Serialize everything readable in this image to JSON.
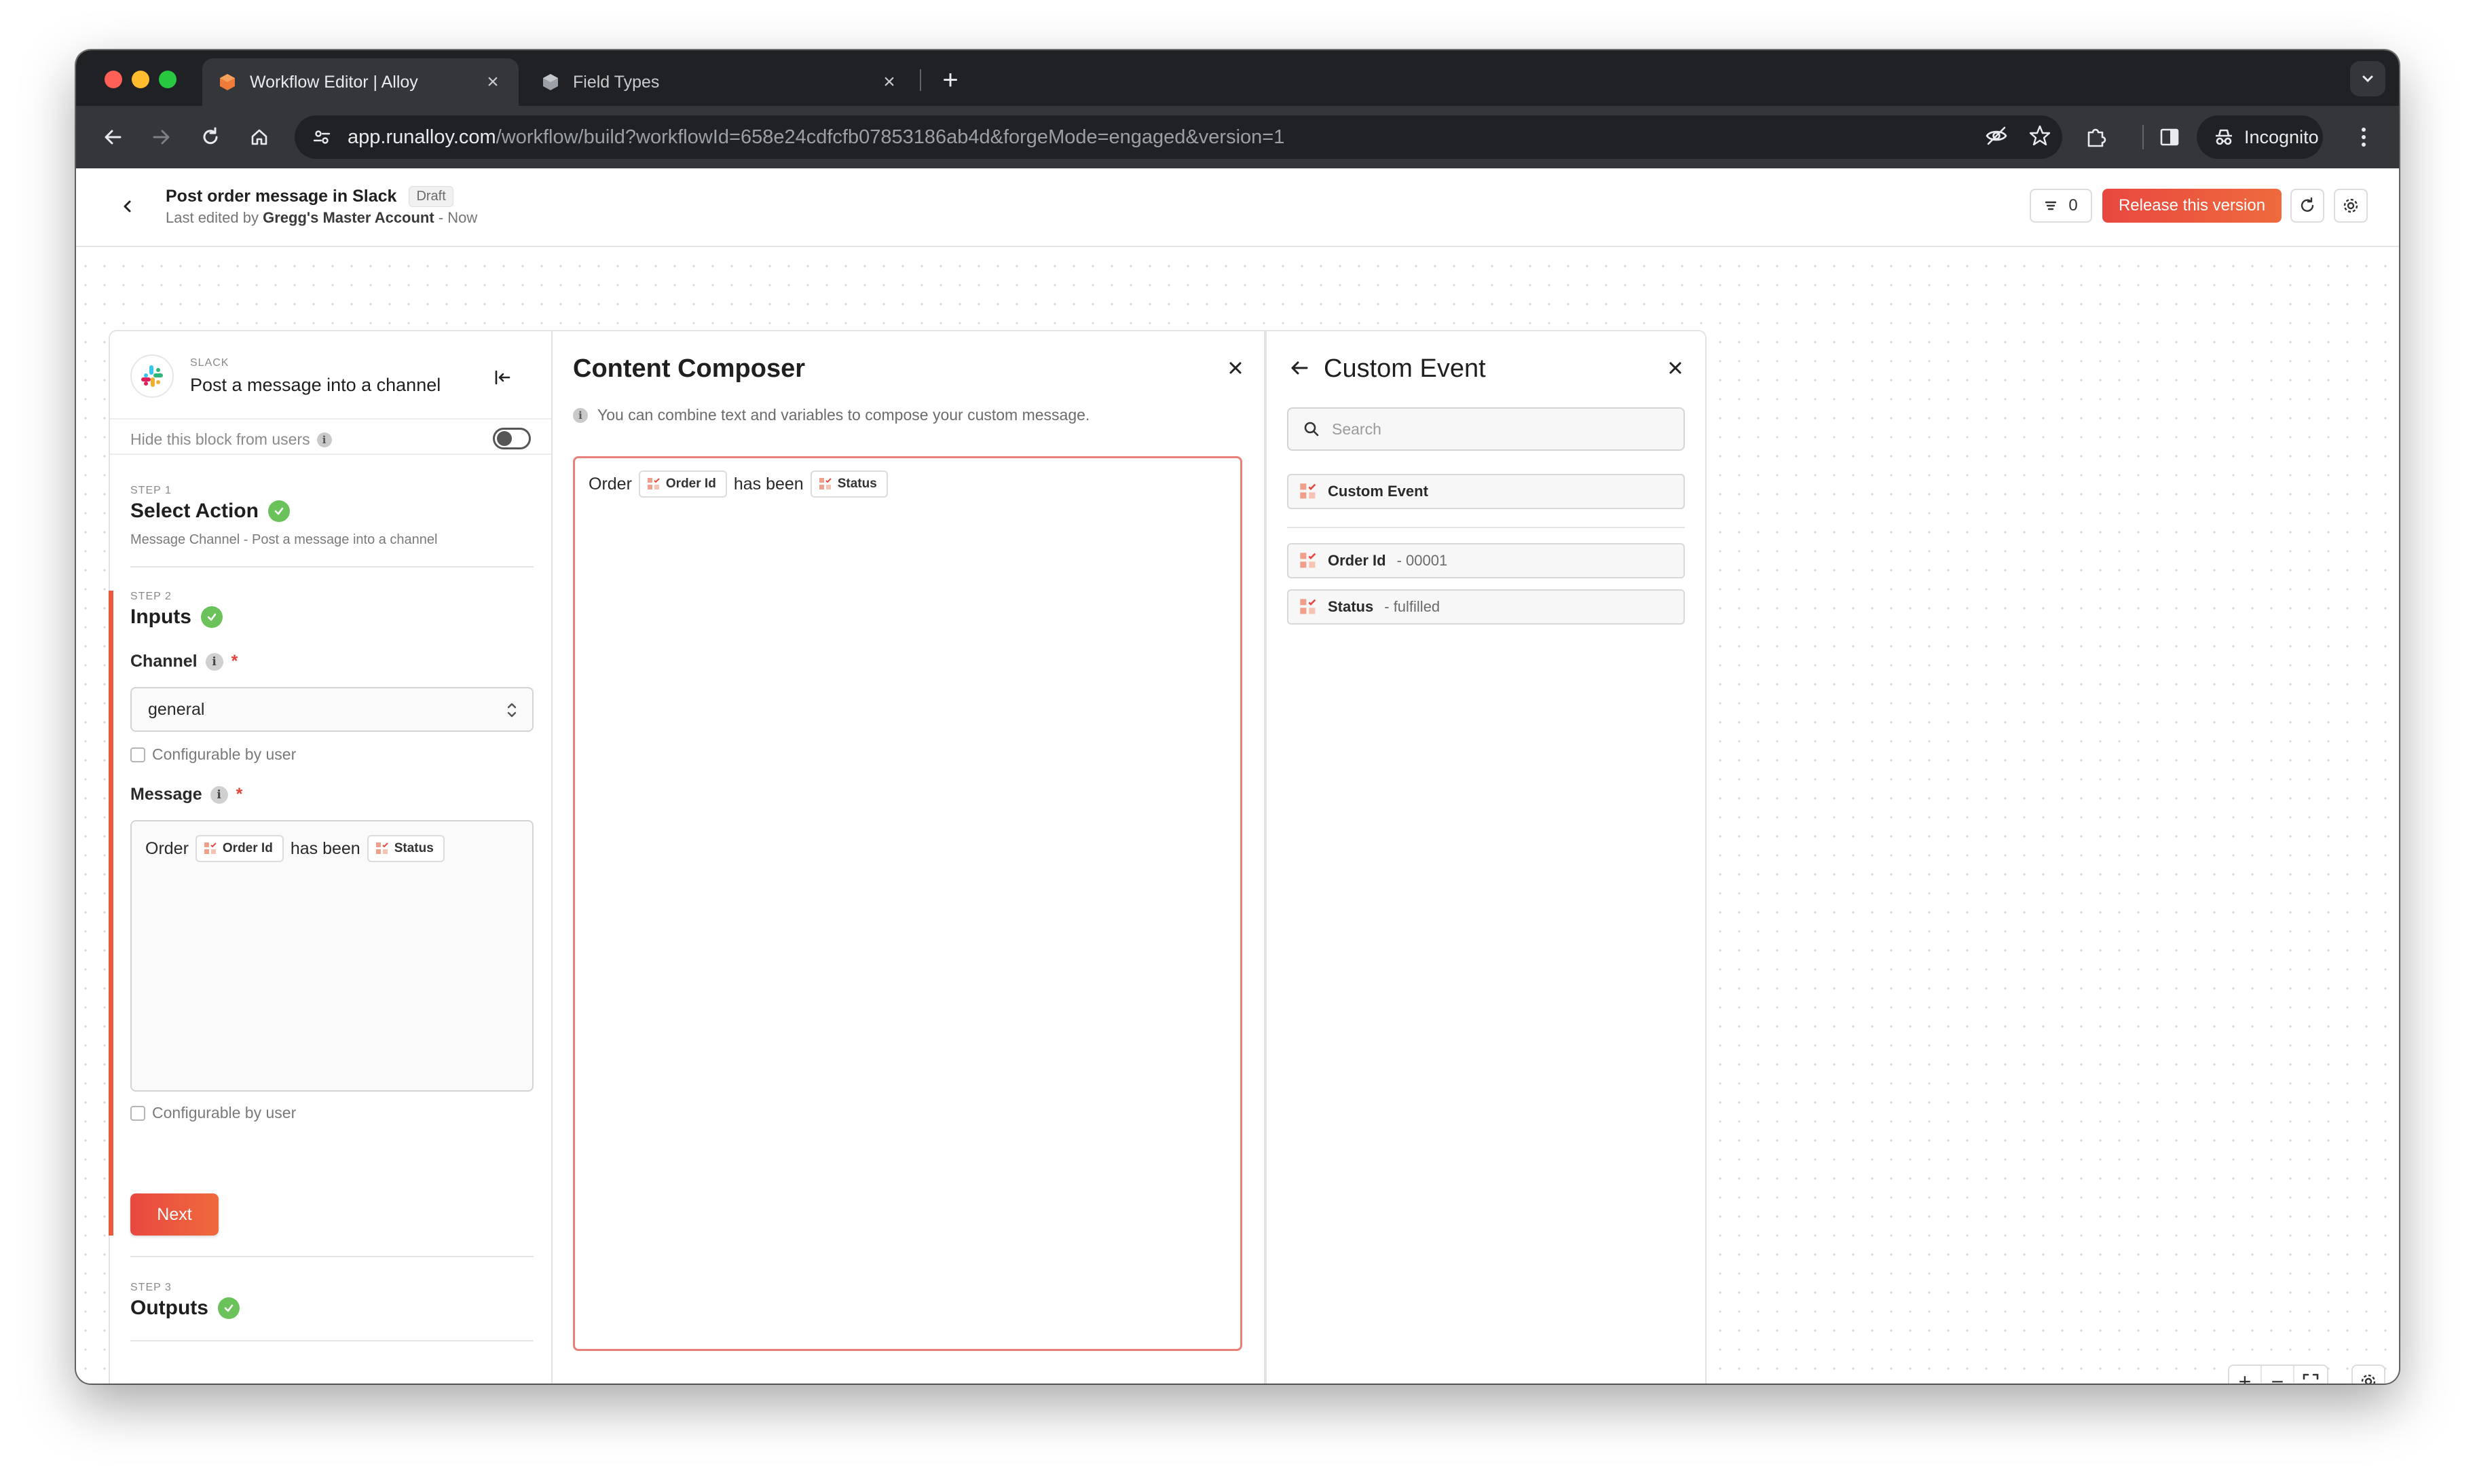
{
  "browser": {
    "tabs": [
      {
        "title": "Workflow Editor | Alloy",
        "active": true
      },
      {
        "title": "Field Types",
        "active": false
      }
    ],
    "url_host": "app.runalloy.com",
    "url_path": "/workflow/build?workflowId=658e24cdfcfb07853186ab4d&forgeMode=engaged&version=1",
    "profile_label": "Incognito"
  },
  "header": {
    "title": "Post order message in Slack",
    "badge": "Draft",
    "last_edited_prefix": "Last edited by",
    "editor": "Gregg's Master Account",
    "edited_suffix": "- Now",
    "count": "0",
    "release_label": "Release this version"
  },
  "block": {
    "app": "SLACK",
    "title": "Post a message into a channel",
    "hide_label": "Hide this block from users",
    "steps": [
      {
        "label": "STEP 1",
        "title": "Select Action",
        "desc": "Message Channel - Post a message into a channel"
      },
      {
        "label": "STEP 2",
        "title": "Inputs"
      },
      {
        "label": "STEP 3",
        "title": "Outputs"
      }
    ],
    "channel_label": "Channel",
    "channel_value": "general",
    "configurable_label": "Configurable by user",
    "message_label": "Message",
    "message": {
      "t1": "Order",
      "chip1": "Order Id",
      "t2": "has been",
      "chip2": "Status"
    },
    "next_label": "Next"
  },
  "composer": {
    "title": "Content Composer",
    "hint": "You can combine text and variables to compose your custom message.",
    "content": {
      "t1": "Order",
      "chip1": "Order Id",
      "t2": "has been",
      "chip2": "Status"
    }
  },
  "custom_event": {
    "title": "Custom Event",
    "search_placeholder": "Search",
    "group": "Custom Event",
    "variables": [
      {
        "name": "Order Id",
        "value": "- 00001"
      },
      {
        "name": "Status",
        "value": "- fulfilled"
      }
    ]
  },
  "zoom_controls": {
    "zoom_in": "+",
    "zoom_out": "−"
  },
  "colors": {
    "accent": "#e8483f",
    "success": "#6bc25a",
    "browser_dark": "#202124"
  }
}
